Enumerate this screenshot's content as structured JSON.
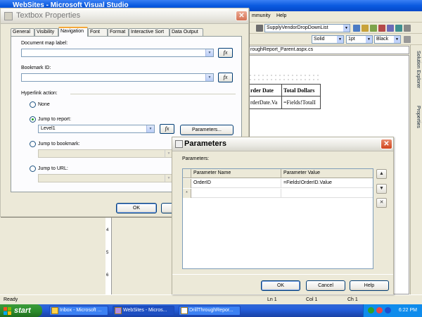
{
  "vs": {
    "title": "WebSites - Microsoft Visual Studio",
    "menu": {
      "community": "mmunity",
      "help": "Help"
    },
    "toolbar": {
      "project_combo": "SupplyVendorDropDownList"
    },
    "format": {
      "style": "Solid",
      "width": "1pt",
      "color": "Black"
    },
    "doc_tab": "roughReport_Parent.aspx.cs",
    "report": {
      "headers": [
        "rder Date",
        "Total Dollars"
      ],
      "cells": [
        "rderDate.Va",
        "=Fields!TotalI"
      ]
    },
    "ruler": [
      "4",
      "5",
      "6"
    ],
    "side_tabs": [
      "Solution Explorer",
      "Properties"
    ],
    "statusbar": {
      "ready": "Ready",
      "ln": "Ln 1",
      "col": "Col 1",
      "ch": "Ch 1"
    }
  },
  "taskbar": {
    "start": "start",
    "items": [
      "Inbox - Microsoft ...",
      "WebSites - Micros...",
      "DrillThroughRepor..."
    ],
    "clock": "6:22 PM"
  },
  "textbox_dialog": {
    "title": "Textbox Properties",
    "tabs": [
      "General",
      "Visibility",
      "Navigation",
      "Font",
      "Format",
      "Interactive Sort",
      "Data Output"
    ],
    "document_map_label": "Document map label:",
    "document_map_value": "",
    "bookmark_label": "Bookmark ID:",
    "bookmark_value": "",
    "hyperlink_label": "Hyperlink action:",
    "options": [
      "None",
      "Jump to report:",
      "Jump to bookmark:",
      "Jump to URL:"
    ],
    "report_value": "Level1",
    "parameters_button": "Parameters...",
    "ok": "OK"
  },
  "parameters_dialog": {
    "title": "Parameters",
    "section_label": "Parameters:",
    "columns": [
      "Parameter Name",
      "Parameter Value"
    ],
    "rows": [
      {
        "name": "OrderID",
        "value": "=Fields!OrderID.Value"
      }
    ],
    "new_row_marker": "*",
    "ok": "OK",
    "cancel": "Cancel",
    "help": "Help"
  },
  "colors": {
    "xp_blue": "#0a5ae0",
    "dialog_face": "#ece9d8",
    "close_red": "#d1451d"
  },
  "icons": [
    "close-icon",
    "fx-icon",
    "move-up-icon",
    "move-down-icon",
    "delete-icon",
    "windows-flag-icon"
  ]
}
